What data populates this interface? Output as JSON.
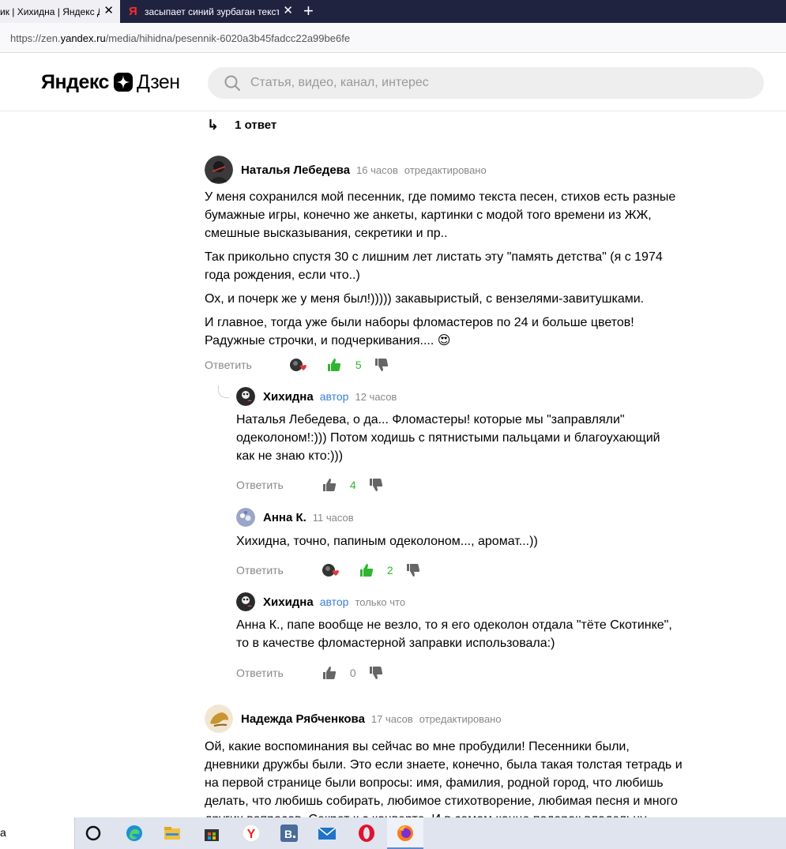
{
  "browser": {
    "tabs": [
      {
        "title": "ик | Хихидна | Яндекс Д",
        "active": true
      },
      {
        "title": "засыпает синий зурбаган текст",
        "active": false
      }
    ],
    "new_tab": "+",
    "close": "✕",
    "url_prefix": "https://zen.",
    "url_domain": "yandex.ru",
    "url_path": "/media/hihidna/pesennik-6020a3b45fadcc22a99be6fe"
  },
  "header": {
    "logo_yandex": "Яндекс",
    "logo_dzen": "Дзен",
    "search_placeholder": "Статья, видео, канал, интерес"
  },
  "reply_count": {
    "arrow": "↳",
    "label": "1 ответ"
  },
  "comments": [
    {
      "name": "Наталья Лебедева",
      "time": "16 часов",
      "edited": "отредактировано",
      "paragraphs": [
        "У меня сохранился мой песенник, где помимо текста песен, стихов есть разные бумажные игры, конечно же анкеты, картинки с модой того времени из ЖЖ, смешные высказывания, секретики и пр..",
        "Так прикольно спустя 30 с лишним лет листать эту \"память детства\" (я с 1974 года рождения, если что..)",
        "Ох, и почерк же у меня был!))))) закавыристый, с вензелями-завитушками.",
        "И главное, тогда уже были наборы фломастеров по 24 и больше цветов! Радужные строчки, и подчеркивания.... 😍"
      ],
      "reply_label": "Ответить",
      "likes": "5",
      "liked": true
    },
    {
      "name": "Хихидна",
      "author_badge": "автор",
      "time": "12 часов",
      "paragraphs": [
        "Наталья Лебедева, о да... Фломастеры! которые мы \"заправляли\" одеколоном!:))) Потом ходишь с пятнистыми пальцами и благоухающий как не знаю кто:)))"
      ],
      "reply_label": "Ответить",
      "likes": "4",
      "liked": false
    },
    {
      "name": "Анна К.",
      "time": "11 часов",
      "paragraphs": [
        "Хихидна, точно, папиным одеколоном..., аромат...))"
      ],
      "reply_label": "Ответить",
      "likes": "2",
      "liked": true
    },
    {
      "name": "Хихидна",
      "author_badge": "автор",
      "time": "только что",
      "paragraphs": [
        "Анна К., папе вообще не везло, то я его одеколон отдала \"тёте Скотинке\", то в качестве фломастерной заправки использовала:)"
      ],
      "reply_label": "Ответить",
      "likes": "0",
      "liked": false
    },
    {
      "name": "Надежда Рябченкова",
      "time": "17 часов",
      "edited": "отредактировано",
      "paragraphs": [
        "Ой, какие воспоминания вы сейчас во мне пробудили! Песенники были, дневники дружбы были. Это если знаете, конечно, была такая толстая тетрадь и на первой странице были вопросы: имя, фамилия, родной город, что любишь делать, что любишь собирать, любимое стихотворение, любимая песня и много других вопросов. Секрет к с конверте. И в самом конце подарок владельцу"
      ]
    }
  ],
  "colors": {
    "like_active": "#2fb52f",
    "muted": "#888888",
    "author": "#3b7fd4",
    "tab_bar": "#202340"
  },
  "taskbar": {
    "search_text": "а",
    "icons": [
      "cortana-icon",
      "edge-icon",
      "explorer-icon",
      "store-icon",
      "yandex-browser-icon",
      "vk-icon",
      "mail-icon",
      "opera-icon",
      "firefox-icon"
    ]
  }
}
